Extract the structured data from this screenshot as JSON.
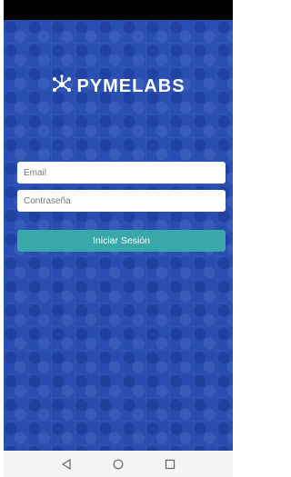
{
  "brand": {
    "logo_text": "PYMELABS",
    "primary_color": "#2a4fb0",
    "accent_color": "#3aa8a8"
  },
  "login": {
    "email_placeholder": "Email",
    "password_placeholder": "Contraseña",
    "submit_label": "Iniciar Sesión"
  },
  "nav": {
    "back_icon": "triangle-back-icon",
    "home_icon": "circle-home-icon",
    "recents_icon": "square-recents-icon"
  }
}
